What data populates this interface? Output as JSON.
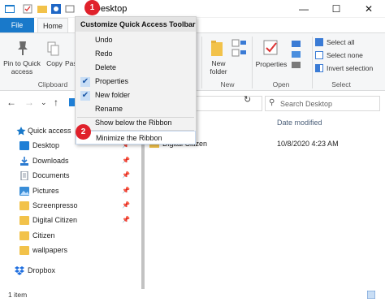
{
  "window": {
    "title": "Desktop",
    "controls": {
      "minimize": "—",
      "maximize": "☐",
      "close": "✕"
    }
  },
  "ribbon": {
    "tabs": [
      "File",
      "Home"
    ],
    "clipboard": {
      "pin_label": "Pin to Quick access",
      "copy_label": "Copy",
      "paste_label": "Paste",
      "group_label": "Clipboard"
    },
    "new": {
      "new_folder_label": "New folder",
      "group_label": "New"
    },
    "open": {
      "properties_label": "Properties",
      "group_label": "Open"
    },
    "select": {
      "select_all": "Select all",
      "select_none": "Select none",
      "invert_selection": "Invert selection",
      "group_label": "Select"
    }
  },
  "address": {
    "search_placeholder": "Search Desktop"
  },
  "nav_pane": {
    "items": [
      {
        "label": "Quick access",
        "icon": "star-icon",
        "color": "#1979ca"
      },
      {
        "label": "Desktop",
        "icon": "desktop-folder-icon",
        "color": "#1e7fd6",
        "pinned": true
      },
      {
        "label": "Downloads",
        "icon": "downloads-icon",
        "color": "#2a7ad0",
        "pinned": true
      },
      {
        "label": "Documents",
        "icon": "documents-icon",
        "color": "#6d7b8d",
        "pinned": true
      },
      {
        "label": "Pictures",
        "icon": "pictures-icon",
        "color": "#3a8ed8",
        "pinned": true
      },
      {
        "label": "Screenpresso",
        "icon": "folder-icon",
        "color": "#f2c24a",
        "pinned": true
      },
      {
        "label": "Digital Citizen",
        "icon": "folder-icon",
        "color": "#f2c24a",
        "pinned": true
      },
      {
        "label": "Citizen",
        "icon": "folder-icon",
        "color": "#f2c24a"
      },
      {
        "label": "wallpapers",
        "icon": "folder-icon",
        "color": "#f2c24a"
      },
      {
        "label": "Dropbox",
        "icon": "dropbox-icon",
        "color": "#1f6fe0"
      }
    ]
  },
  "content": {
    "columns": {
      "date_modified": "Date modified"
    },
    "rows": [
      {
        "name": "Digital Citizen",
        "date": "10/8/2020 4:23 AM"
      }
    ]
  },
  "status_bar": {
    "item_count": "1 item"
  },
  "qat_menu": {
    "title": "Customize Quick Access Toolbar",
    "items": [
      {
        "label": "Undo",
        "checked": false
      },
      {
        "label": "Redo",
        "checked": false
      },
      {
        "label": "Delete",
        "checked": false
      },
      {
        "label": "Properties",
        "checked": true
      },
      {
        "label": "New folder",
        "checked": true
      },
      {
        "label": "Rename",
        "checked": false
      },
      {
        "label": "Show below the Ribbon",
        "checked": false
      },
      {
        "label": "Minimize the Ribbon",
        "checked": false
      }
    ]
  },
  "badges": {
    "first": "1",
    "second": "2"
  },
  "colors": {
    "accent": "#1979ca",
    "badge": "#e0212b"
  }
}
